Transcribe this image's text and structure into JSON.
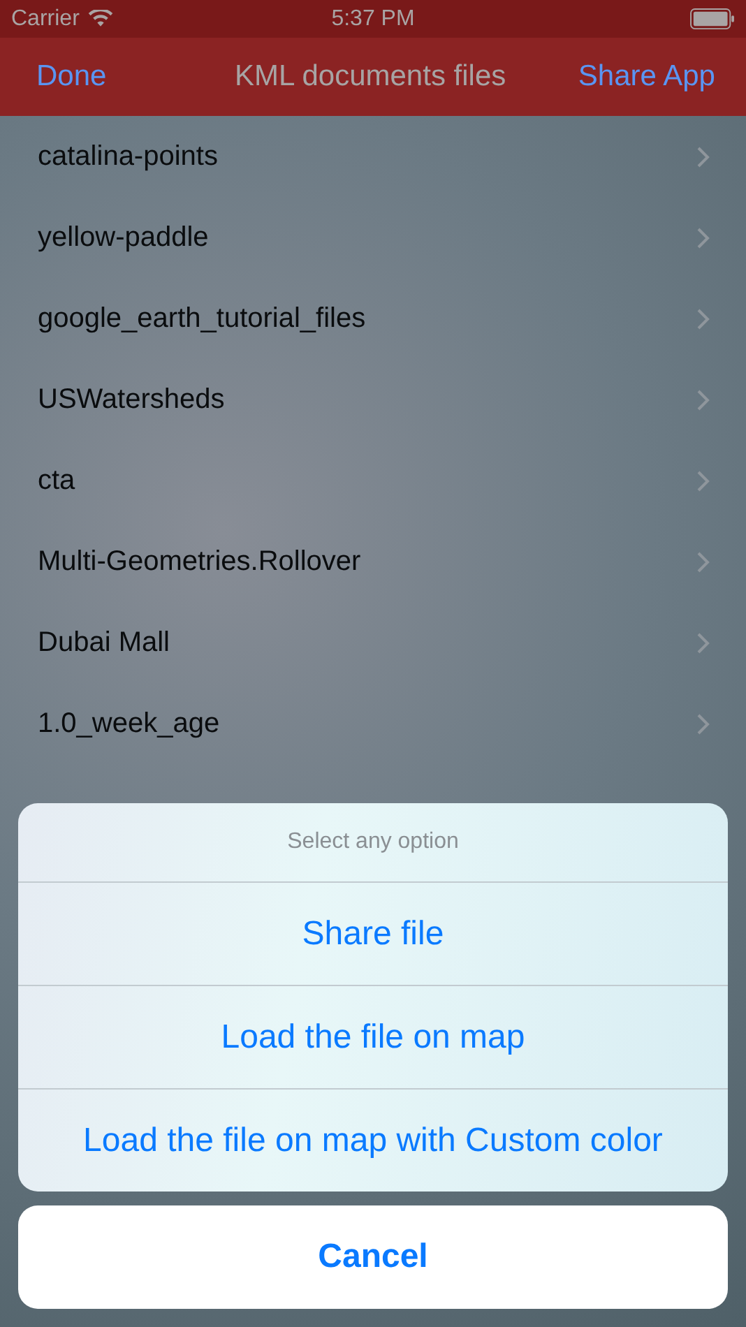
{
  "status_bar": {
    "carrier": "Carrier",
    "time": "5:37 PM"
  },
  "nav_bar": {
    "left_button": "Done",
    "title": "KML documents files",
    "right_button": "Share App"
  },
  "files": [
    {
      "name": "catalina-points"
    },
    {
      "name": "yellow-paddle"
    },
    {
      "name": "google_earth_tutorial_files"
    },
    {
      "name": "USWatersheds"
    },
    {
      "name": "cta"
    },
    {
      "name": "Multi-Geometries.Rollover"
    },
    {
      "name": "Dubai Mall"
    },
    {
      "name": "1.0_week_age"
    }
  ],
  "action_sheet": {
    "title": "Select any option",
    "options": [
      "Share file",
      "Load the file on map",
      "Load the file on map with Custom color"
    ],
    "cancel": "Cancel"
  }
}
